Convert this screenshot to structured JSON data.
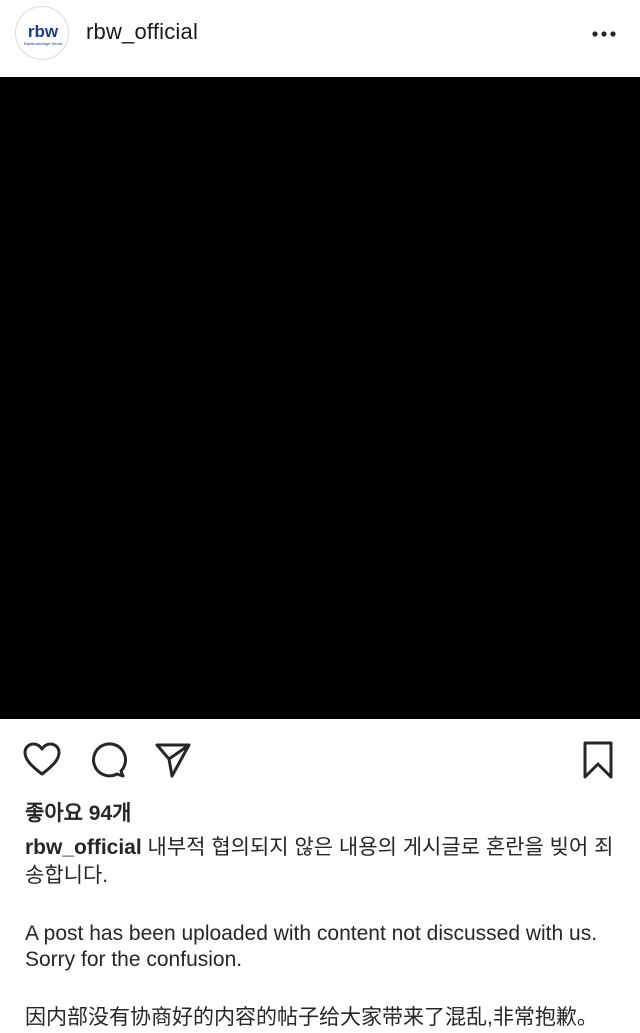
{
  "header": {
    "username": "rbw_official",
    "avatar_logo_text": "rbw",
    "avatar_logo_subtext": "Rainbowbridge World",
    "more_icon": "more-horizontal-icon"
  },
  "post": {
    "media_color": "#000000"
  },
  "actions": {
    "like_icon": "heart-icon",
    "comment_icon": "comment-icon",
    "share_icon": "send-icon",
    "save_icon": "bookmark-icon"
  },
  "likes_text": "좋아요 94개",
  "caption": {
    "username": "rbw_official",
    "text_ko": "내부적 협의되지 않은 내용의 게시글로 혼란을 빚어 죄송합니다.",
    "text_en": "A post has been uploaded with content not discussed with us. Sorry for the confusion.",
    "text_zh": "因内部没有协商好的内容的帖子给大家带来了混乱,非常抱歉。"
  },
  "colors": {
    "text": "#262626",
    "logo_blue": "#1f3b8c"
  }
}
